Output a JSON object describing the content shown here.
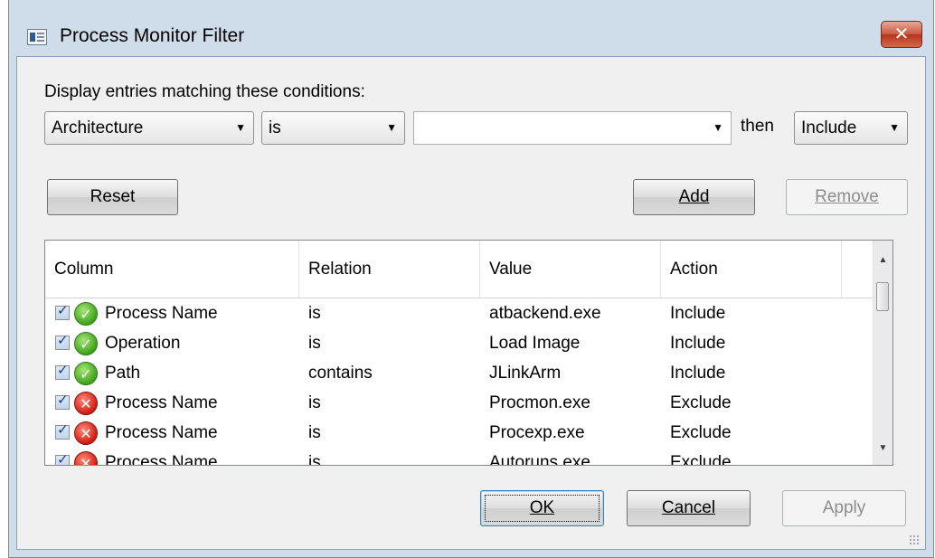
{
  "window": {
    "title": "Process Monitor Filter"
  },
  "prompt": "Display entries matching these conditions:",
  "condition": {
    "column": "Architecture",
    "relation": "is",
    "value": "",
    "then_label": "then",
    "action": "Include"
  },
  "buttons": {
    "reset": "Reset",
    "add": "Add",
    "remove": "Remove",
    "ok": "OK",
    "cancel": "Cancel",
    "apply": "Apply"
  },
  "table": {
    "headers": [
      "Column",
      "Relation",
      "Value",
      "Action"
    ],
    "rows": [
      {
        "enabled": true,
        "status_icon": "include-check-icon",
        "column": "Process Name",
        "relation": "is",
        "value": "atbackend.exe",
        "action": "Include"
      },
      {
        "enabled": true,
        "status_icon": "include-check-icon",
        "column": "Operation",
        "relation": "is",
        "value": "Load Image",
        "action": "Include"
      },
      {
        "enabled": true,
        "status_icon": "include-check-icon",
        "column": "Path",
        "relation": "contains",
        "value": "JLinkArm",
        "action": "Include"
      },
      {
        "enabled": true,
        "status_icon": "exclude-x-icon",
        "column": "Process Name",
        "relation": "is",
        "value": "Procmon.exe",
        "action": "Exclude"
      },
      {
        "enabled": true,
        "status_icon": "exclude-x-icon",
        "column": "Process Name",
        "relation": "is",
        "value": "Procexp.exe",
        "action": "Exclude"
      },
      {
        "enabled": true,
        "status_icon": "exclude-x-icon",
        "column": "Process Name",
        "relation": "is",
        "value": "Autoruns.exe",
        "action": "Exclude"
      }
    ]
  },
  "colors": {
    "include": "#3ea319",
    "exclude": "#d11b12",
    "frame": "#cfdcea"
  }
}
